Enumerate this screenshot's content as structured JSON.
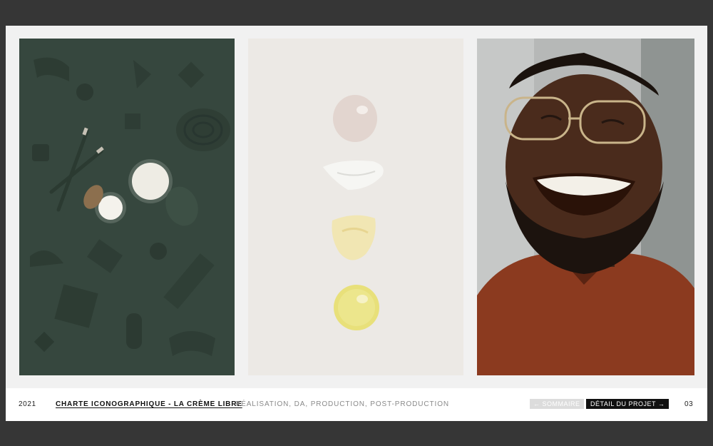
{
  "gallery": {
    "images": [
      {
        "name": "green-flatlay-jars-toothbrushes",
        "bg": "#394a40"
      },
      {
        "name": "cream-texture-swatches",
        "bg": "#ece9e5"
      },
      {
        "name": "smiling-man-portrait",
        "bg": "#b6b8b7"
      }
    ]
  },
  "footer": {
    "year": "2021",
    "title": "CHARTE ICONOGRAPHIQUE - LA CRÈME LIBRE",
    "description": "RÉALISATION, DA, PRODUCTION, POST-PRODUCTION",
    "back_label": "← SOMMAIRE",
    "detail_label": "DÉTAIL DU PROJET →",
    "page_number": "03"
  }
}
